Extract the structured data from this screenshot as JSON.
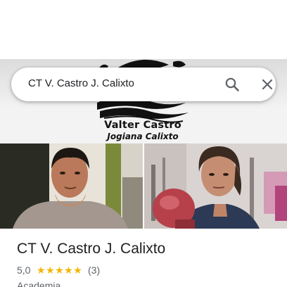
{
  "search": {
    "query": "CT V. Castro J. Calixto"
  },
  "hero": {
    "logo_line1": "Valter Castro",
    "logo_line2": "Jogiana Calixto"
  },
  "place": {
    "name": "CT V. Castro J. Calixto",
    "rating": "5,0",
    "stars": "★★★★★",
    "reviews": "(3)",
    "category": "Academia"
  },
  "colors": {
    "star": "#f4b400",
    "text_primary": "#202124",
    "text_secondary": "#5f6368"
  }
}
